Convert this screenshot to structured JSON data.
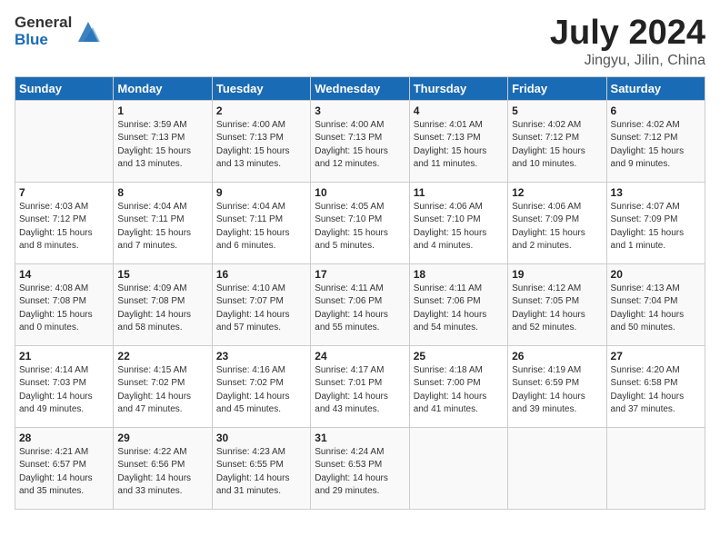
{
  "header": {
    "logo_general": "General",
    "logo_blue": "Blue",
    "month": "July 2024",
    "location": "Jingyu, Jilin, China"
  },
  "days_of_week": [
    "Sunday",
    "Monday",
    "Tuesday",
    "Wednesday",
    "Thursday",
    "Friday",
    "Saturday"
  ],
  "weeks": [
    [
      {
        "day": "",
        "info": ""
      },
      {
        "day": "1",
        "info": "Sunrise: 3:59 AM\nSunset: 7:13 PM\nDaylight: 15 hours\nand 13 minutes."
      },
      {
        "day": "2",
        "info": "Sunrise: 4:00 AM\nSunset: 7:13 PM\nDaylight: 15 hours\nand 13 minutes."
      },
      {
        "day": "3",
        "info": "Sunrise: 4:00 AM\nSunset: 7:13 PM\nDaylight: 15 hours\nand 12 minutes."
      },
      {
        "day": "4",
        "info": "Sunrise: 4:01 AM\nSunset: 7:13 PM\nDaylight: 15 hours\nand 11 minutes."
      },
      {
        "day": "5",
        "info": "Sunrise: 4:02 AM\nSunset: 7:12 PM\nDaylight: 15 hours\nand 10 minutes."
      },
      {
        "day": "6",
        "info": "Sunrise: 4:02 AM\nSunset: 7:12 PM\nDaylight: 15 hours\nand 9 minutes."
      }
    ],
    [
      {
        "day": "7",
        "info": "Sunrise: 4:03 AM\nSunset: 7:12 PM\nDaylight: 15 hours\nand 8 minutes."
      },
      {
        "day": "8",
        "info": "Sunrise: 4:04 AM\nSunset: 7:11 PM\nDaylight: 15 hours\nand 7 minutes."
      },
      {
        "day": "9",
        "info": "Sunrise: 4:04 AM\nSunset: 7:11 PM\nDaylight: 15 hours\nand 6 minutes."
      },
      {
        "day": "10",
        "info": "Sunrise: 4:05 AM\nSunset: 7:10 PM\nDaylight: 15 hours\nand 5 minutes."
      },
      {
        "day": "11",
        "info": "Sunrise: 4:06 AM\nSunset: 7:10 PM\nDaylight: 15 hours\nand 4 minutes."
      },
      {
        "day": "12",
        "info": "Sunrise: 4:06 AM\nSunset: 7:09 PM\nDaylight: 15 hours\nand 2 minutes."
      },
      {
        "day": "13",
        "info": "Sunrise: 4:07 AM\nSunset: 7:09 PM\nDaylight: 15 hours\nand 1 minute."
      }
    ],
    [
      {
        "day": "14",
        "info": "Sunrise: 4:08 AM\nSunset: 7:08 PM\nDaylight: 15 hours\nand 0 minutes."
      },
      {
        "day": "15",
        "info": "Sunrise: 4:09 AM\nSunset: 7:08 PM\nDaylight: 14 hours\nand 58 minutes."
      },
      {
        "day": "16",
        "info": "Sunrise: 4:10 AM\nSunset: 7:07 PM\nDaylight: 14 hours\nand 57 minutes."
      },
      {
        "day": "17",
        "info": "Sunrise: 4:11 AM\nSunset: 7:06 PM\nDaylight: 14 hours\nand 55 minutes."
      },
      {
        "day": "18",
        "info": "Sunrise: 4:11 AM\nSunset: 7:06 PM\nDaylight: 14 hours\nand 54 minutes."
      },
      {
        "day": "19",
        "info": "Sunrise: 4:12 AM\nSunset: 7:05 PM\nDaylight: 14 hours\nand 52 minutes."
      },
      {
        "day": "20",
        "info": "Sunrise: 4:13 AM\nSunset: 7:04 PM\nDaylight: 14 hours\nand 50 minutes."
      }
    ],
    [
      {
        "day": "21",
        "info": "Sunrise: 4:14 AM\nSunset: 7:03 PM\nDaylight: 14 hours\nand 49 minutes."
      },
      {
        "day": "22",
        "info": "Sunrise: 4:15 AM\nSunset: 7:02 PM\nDaylight: 14 hours\nand 47 minutes."
      },
      {
        "day": "23",
        "info": "Sunrise: 4:16 AM\nSunset: 7:02 PM\nDaylight: 14 hours\nand 45 minutes."
      },
      {
        "day": "24",
        "info": "Sunrise: 4:17 AM\nSunset: 7:01 PM\nDaylight: 14 hours\nand 43 minutes."
      },
      {
        "day": "25",
        "info": "Sunrise: 4:18 AM\nSunset: 7:00 PM\nDaylight: 14 hours\nand 41 minutes."
      },
      {
        "day": "26",
        "info": "Sunrise: 4:19 AM\nSunset: 6:59 PM\nDaylight: 14 hours\nand 39 minutes."
      },
      {
        "day": "27",
        "info": "Sunrise: 4:20 AM\nSunset: 6:58 PM\nDaylight: 14 hours\nand 37 minutes."
      }
    ],
    [
      {
        "day": "28",
        "info": "Sunrise: 4:21 AM\nSunset: 6:57 PM\nDaylight: 14 hours\nand 35 minutes."
      },
      {
        "day": "29",
        "info": "Sunrise: 4:22 AM\nSunset: 6:56 PM\nDaylight: 14 hours\nand 33 minutes."
      },
      {
        "day": "30",
        "info": "Sunrise: 4:23 AM\nSunset: 6:55 PM\nDaylight: 14 hours\nand 31 minutes."
      },
      {
        "day": "31",
        "info": "Sunrise: 4:24 AM\nSunset: 6:53 PM\nDaylight: 14 hours\nand 29 minutes."
      },
      {
        "day": "",
        "info": ""
      },
      {
        "day": "",
        "info": ""
      },
      {
        "day": "",
        "info": ""
      }
    ]
  ]
}
